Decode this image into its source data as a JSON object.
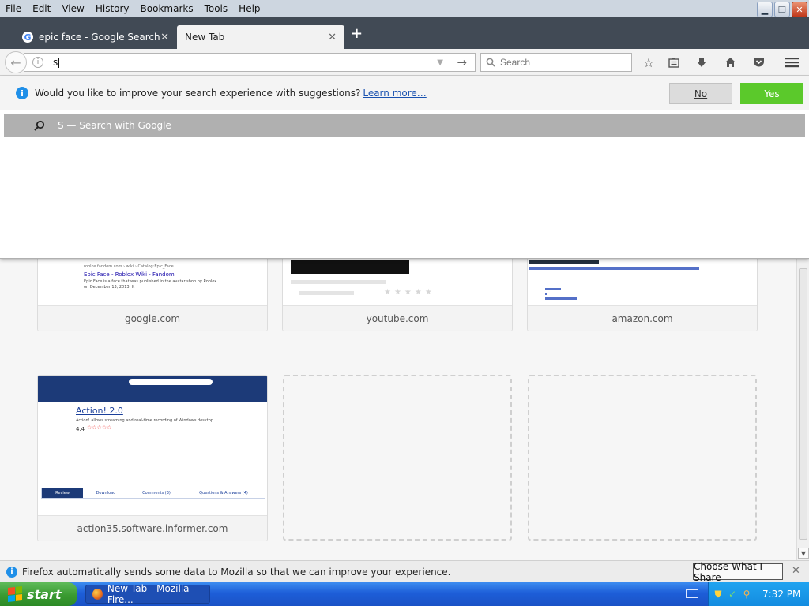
{
  "menu": [
    {
      "label": "File",
      "key": "F",
      "rest": "ile"
    },
    {
      "label": "Edit",
      "key": "E",
      "rest": "dit"
    },
    {
      "label": "View",
      "key": "V",
      "rest": "iew"
    },
    {
      "label": "History",
      "key": "H",
      "rest": "istory"
    },
    {
      "label": "Bookmarks",
      "key": "B",
      "rest": "ookmarks"
    },
    {
      "label": "Tools",
      "key": "T",
      "rest": "ools"
    },
    {
      "label": "Help",
      "key": "H",
      "rest": "elp"
    }
  ],
  "tabs": [
    {
      "title": "epic face - Google Search",
      "favicon": "google-icon",
      "active": false
    },
    {
      "title": "New Tab",
      "active": true
    }
  ],
  "nav": {
    "url_value": "s",
    "search_placeholder": "Search"
  },
  "suggest": {
    "prompt": "Would you like to improve your search experience with suggestions?",
    "learn_more": "Learn more…",
    "no_label": "No",
    "yes_label": "Yes",
    "row_text": "S — Search with Google"
  },
  "tiles": [
    {
      "label": "google.com"
    },
    {
      "label": "youtube.com"
    },
    {
      "label": "amazon.com"
    },
    {
      "label": "action35.software.informer.com"
    }
  ],
  "tile_thumbs": {
    "google_title": "Epic Face - Roblox Wiki - Fandom",
    "google_url": "roblox.fandom.com › wiki › Catalog:Epic_Face",
    "google_desc": "Epic Face is a face that was published in the avatar shop by Roblox on December 13, 2013. It",
    "action_title": "Action! 2.0",
    "action_desc": "Action! allows streaming and real-time recording of Windows desktop",
    "action_rating": "4.4",
    "action_tabs": [
      "Review",
      "Download",
      "Comments (3)",
      "Questions & Answers (4)"
    ]
  },
  "notify": {
    "message": "Firefox automatically sends some data to Mozilla so that we can improve your experience.",
    "button": "Choose What I Share"
  },
  "taskbar": {
    "start": "start",
    "window_title": "New Tab - Mozilla Fire...",
    "clock": "7:32 PM"
  },
  "colors": {
    "accent_yes": "#5bc92b",
    "info_blue": "#1f8fe8",
    "tab_strip": "#414a55",
    "taskbar_blue": "#1d5ed8"
  }
}
